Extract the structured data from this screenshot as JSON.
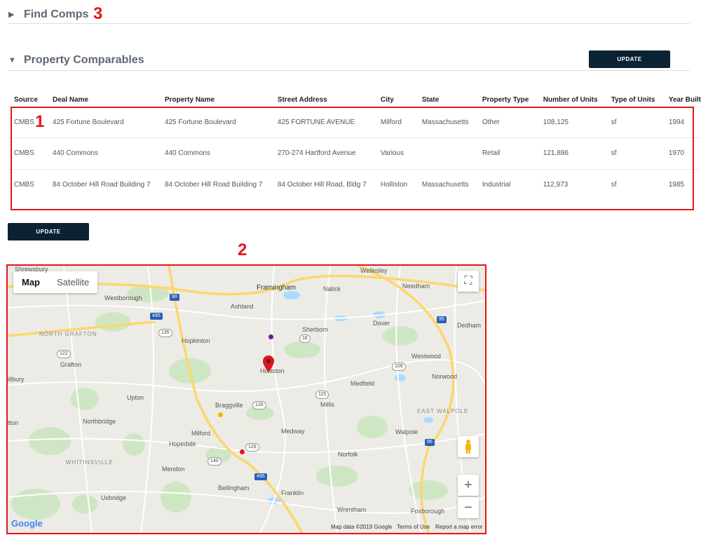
{
  "find_comps": {
    "title": "Find Comps",
    "caret": "▶"
  },
  "property_comparables": {
    "title": "Property Comparables",
    "caret": "▼"
  },
  "buttons": {
    "update_top": "UPDATE",
    "update_bottom": "UPDATE"
  },
  "annotations": [
    "1",
    "2",
    "3"
  ],
  "table": {
    "headers": [
      "Source",
      "Deal Name",
      "Property Name",
      "Street Address",
      "City",
      "State",
      "Property Type",
      "Number of Units",
      "Type of Units",
      "Year Built"
    ],
    "rows": [
      [
        "CMBS",
        "425 Fortune Boulevard",
        "425 Fortune Boulevard",
        "425 FORTUNE AVENUE",
        "Milford",
        "Massachusetts",
        "Other",
        "108,125",
        "sf",
        "1994"
      ],
      [
        "CMBS",
        "440 Commons",
        "440 Commons",
        "270-274 Hartford Avenue",
        "Various",
        "",
        "Retail",
        "121,886",
        "sf",
        "1970"
      ],
      [
        "CMBS",
        "84 October Hill Road Building 7",
        "84 October Hill Road Building 7",
        "84 October Hill Road, Bldg 7",
        "Holliston",
        "Massachusetts",
        "Industrial",
        "112,973",
        "sf",
        "1985"
      ]
    ]
  },
  "map": {
    "type_map": "Map",
    "type_satellite": "Satellite",
    "zoom_in": "+",
    "zoom_out": "−",
    "fullscreen": "⛶",
    "places": {
      "framingham": "Framingham",
      "natick": "Natick",
      "wellesley": "Wellesley",
      "needham": "Needham",
      "westborough": "Westborough",
      "ashland": "Ashland",
      "dover": "Dover",
      "dedham": "Dedham",
      "north_grafton": "NORTH GRAFTON",
      "hopkinton": "Hopkinton",
      "sherborn": "Sherborn",
      "westwood": "Westwood",
      "grafton": "Grafton",
      "holliston": "Holliston",
      "norwood": "Norwood",
      "medfield": "Medfield",
      "upton": "Upton",
      "braggville": "Braggville",
      "millis": "Millis",
      "east_walpole": "EAST WALPOLE",
      "northbridge": "Northbridge",
      "milford": "Milford",
      "medway": "Medway",
      "walpole": "Walpole",
      "hopedale": "Hopedale",
      "norfolk": "Norfolk",
      "whitinsville": "WHITINSVILLE",
      "mendon": "Mendon",
      "bellingham": "Bellingham",
      "franklin": "Franklin",
      "uxbridge": "Uxbridge",
      "wrentham": "Wrentham",
      "foxborough": "Foxborough",
      "shrewsbury": "Shrewsbury",
      "millbury": "illbury",
      "sutton": "tton"
    },
    "footer": {
      "logo": "Google",
      "data": "Map data ©2019 Google",
      "terms": "Terms of Use",
      "report": "Report a map error"
    },
    "colors": {
      "marker_red": "#e3161d",
      "marker_purple": "#6a1b9a",
      "marker_yellow": "#f2b705",
      "marker_pin": "#d8161f"
    }
  }
}
